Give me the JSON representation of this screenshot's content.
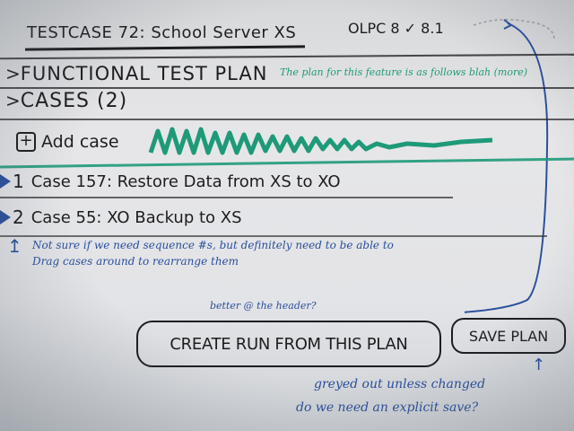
{
  "header": {
    "testcase_title": "TESTCASE 72: School Server XS",
    "version": "OLPC 8 ✓ 8.1"
  },
  "functional_test_plan": {
    "caret": ">",
    "title": "FUNCTIONAL TEST PLAN",
    "note": "The plan for this feature is as follows blah (more)"
  },
  "cases_section": {
    "caret": ">",
    "title": "CASES (2)"
  },
  "add_case": {
    "icon": "plus-icon",
    "label": "Add case"
  },
  "cases": [
    {
      "number": "1",
      "label": "Case 157: Restore Data from XS to XO"
    },
    {
      "number": "2",
      "label": "Case 55: XO Backup to XS"
    }
  ],
  "notes": {
    "sequence_note_line1": "Not sure if we need sequence #s, but definitely need to be able to",
    "sequence_note_line2": "Drag cases around to rearrange them",
    "header_note": "better @ the header?",
    "greyed_note": "greyed out unless changed",
    "explicit_save_note": "do we need an explicit save?"
  },
  "buttons": {
    "create_run": "CREATE RUN FROM THIS PLAN",
    "save_plan": "SAVE PLAN"
  },
  "colors": {
    "marker_black": "#1d1d1f",
    "marker_blue": "#2a4f9c",
    "marker_teal": "#1e9a79"
  }
}
